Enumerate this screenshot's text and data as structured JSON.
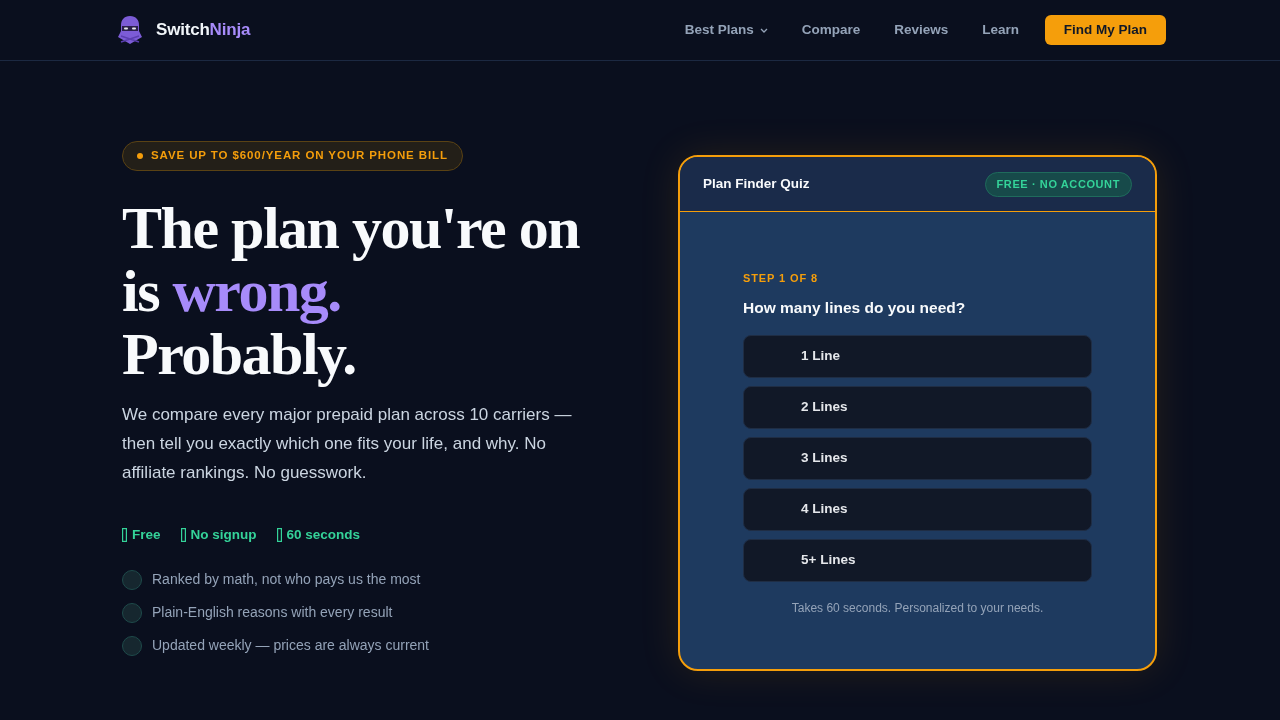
{
  "nav": {
    "logo": {
      "text": "Switch",
      "highlight": "Ninja"
    },
    "links": [
      {
        "label": "Best Plans",
        "dropdown": true
      },
      {
        "label": "Compare",
        "dropdown": false
      },
      {
        "label": "Reviews",
        "dropdown": false
      },
      {
        "label": "Learn",
        "dropdown": false
      }
    ],
    "cta": "Find My Plan"
  },
  "hero": {
    "badge": "SAVE UP TO $600/YEAR ON YOUR PHONE BILL",
    "heading": {
      "text": "The plan you're on is",
      "highlight": "wrong.",
      "after": "Probably."
    },
    "description": "We compare every major prepaid plan across 10 carriers — then tell you exactly which one fits your life, and why. No affiliate rankings. No guesswork.",
    "perks": [
      "Free",
      "No signup",
      "60 seconds"
    ],
    "features": [
      "Ranked by math, not who pays us the most",
      "Plain-English reasons with every result",
      "Updated weekly — prices are always current"
    ]
  },
  "quiz": {
    "title": "Plan Finder Quiz",
    "badge": "FREE · NO ACCOUNT",
    "step": "STEP 1 OF 8",
    "question": "How many lines do you need?",
    "options": [
      {
        "label": "1 Line",
        "selected": false
      },
      {
        "label": "2 Lines",
        "selected": false
      },
      {
        "label": "3 Lines",
        "selected": false
      },
      {
        "label": "4 Lines",
        "selected": false
      },
      {
        "label": "5+ Lines",
        "selected": false
      }
    ],
    "note": "Takes 60 seconds. Personalized to your needs."
  }
}
